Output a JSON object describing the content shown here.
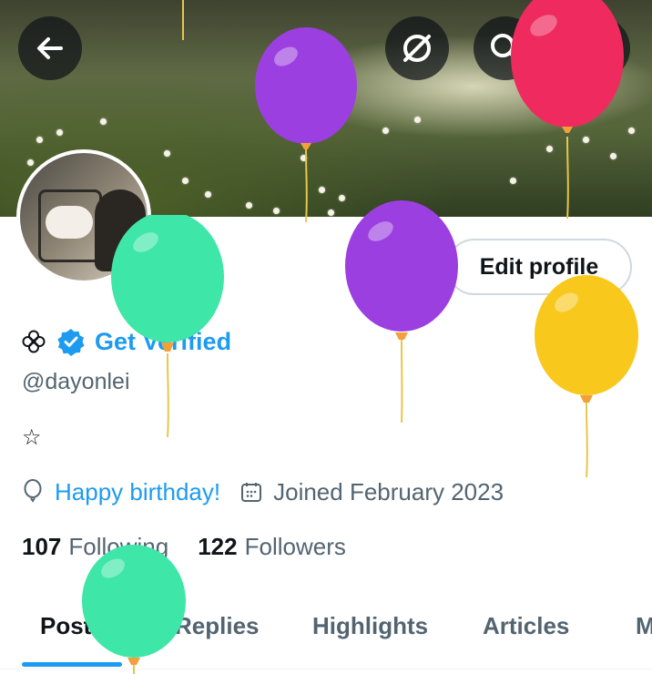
{
  "header": {
    "icons": [
      "back-arrow-icon",
      "grok-icon",
      "search-icon",
      "more-vertical-icon"
    ]
  },
  "profile": {
    "avatar_icon": "avatar",
    "edit_button_label": "Edit profile",
    "name_icon": "flower-icon",
    "verified_label": "Get Verified",
    "handle": "@dayonlei",
    "bio": "☆",
    "birthday_text": "Happy birthday!",
    "joined_text": "Joined February 2023",
    "following_count": "107",
    "following_label": "Following",
    "followers_count": "122",
    "followers_label": "Followers"
  },
  "tabs": [
    {
      "label": "Posts",
      "active": true
    },
    {
      "label": "Replies"
    },
    {
      "label": "Highlights"
    },
    {
      "label": "Articles"
    },
    {
      "label": "M"
    }
  ],
  "colors": {
    "accent": "#1d9bf0",
    "text_primary": "#0f1419",
    "text_secondary": "#536471",
    "balloon_purple": "#9b3fe0",
    "balloon_pink": "#ee2a5e",
    "balloon_green": "#3ee6a8",
    "balloon_yellow": "#f8c81d"
  }
}
